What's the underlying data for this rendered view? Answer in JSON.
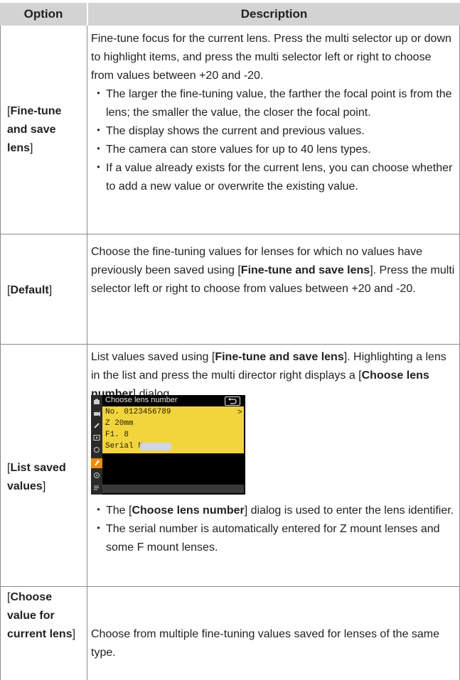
{
  "header": {
    "option": "Option",
    "description": "Description"
  },
  "rows": {
    "fine_tune": {
      "option_open": "[",
      "option_bold": "Fine-tune and save lens",
      "option_close": "]",
      "intro": "Fine-tune focus for the current lens. Press the multi selector up or down to highlight items, and press the multi selector left or right to choose from values between +20 and -20.",
      "bullets": [
        "The larger the fine-tuning value, the farther the focal point is from the lens; the smaller the value, the closer the focal point.",
        "The display shows the current and previous values.",
        "The camera can store values for up to 40 lens types.",
        "If a value already exists for the current lens, you can choose whether to add a new value or overwrite the existing value."
      ]
    },
    "default": {
      "option_open": "[",
      "option_bold": "Default",
      "option_close": "]",
      "text_1": "Choose the fine-tuning values for lenses for which no values have previously been saved using [",
      "text_bold": "Fine-tune and save lens",
      "text_2": "]. Press the multi selector left or right to choose from values between +20 and -20."
    },
    "list_saved": {
      "option_open": "[",
      "option_bold": "List saved values",
      "option_close": "]",
      "text_1": "List values saved using [",
      "text_bold_1": "Fine-tune and save lens",
      "text_2": "]. Highlighting a lens in the list and press the multi director right displays a [",
      "text_bold_2": "Choose lens number",
      "text_3": "] dialog.",
      "screen": {
        "title": "Choose lens number",
        "lines": [
          "No. 0123456789",
          "Z 20mm",
          "F1. 8",
          "Serial No."
        ],
        "chevron": ">"
      },
      "bullet_1_a": "The [",
      "bullet_1_bold": "Choose lens number",
      "bullet_1_b": "] dialog is used to enter the lens identifier.",
      "bullet_2": "The serial number is automatically entered for Z mount lenses and some F mount lenses."
    },
    "choose_value": {
      "option_open": "[",
      "option_bold": "Choose value for current lens",
      "option_close": "]",
      "text": "Choose from multiple fine-tuning values saved for lenses of the same type."
    }
  },
  "bullet_glyph": "・",
  "colors": {
    "header_bg": "#d3d3d3",
    "panel_yellow": "#f2d43c",
    "active_tab": "#f18b00"
  }
}
